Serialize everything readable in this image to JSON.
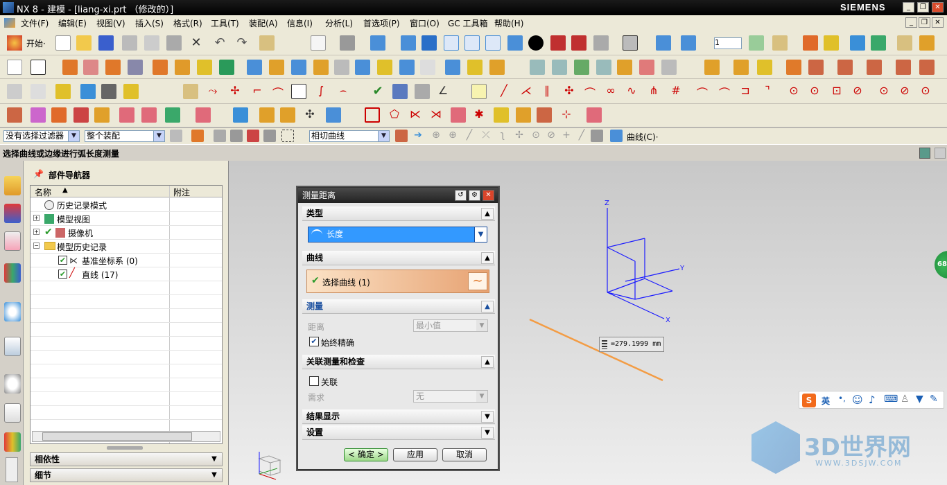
{
  "window": {
    "title": "NX 8 - 建模 - [liang-xi.prt （修改的）]",
    "brand": "SIEMENS",
    "buttons": [
      "_",
      "❐",
      "✕"
    ]
  },
  "menubar": {
    "items": [
      "文件(F)",
      "编辑(E)",
      "视图(V)",
      "插入(S)",
      "格式(R)",
      "工具(T)",
      "装配(A)",
      "信息(I)",
      "分析(L)",
      "首选项(P)",
      "窗口(O)",
      "GC 工具箱",
      "帮助(H)"
    ]
  },
  "toolbar": {
    "start_label": "开始·"
  },
  "filterbar": {
    "filter": "没有选择过滤器",
    "scope": "整个装配",
    "curve_rule": "相切曲线",
    "curve_menu": "曲线(C)·"
  },
  "status": {
    "prompt": "选择曲线或边缘进行弧长度测量"
  },
  "navigator": {
    "title": "部件导航器",
    "columns": [
      "名称",
      "附注"
    ],
    "rows": [
      "历史记录模式",
      "模型视图",
      "摄像机",
      "模型历史记录",
      "基准坐标系 (0)",
      "直线 (17)"
    ],
    "sections": [
      "相依性",
      "细节"
    ]
  },
  "dialog": {
    "title": "测量距离",
    "type_section": "类型",
    "type_value": "长度",
    "curve_section": "曲线",
    "select_curve": "选择曲线 (1)",
    "measure_section": "测量",
    "distance_label": "距离",
    "distance_value": "最小值",
    "always_accurate": "始终精确",
    "assoc_section": "关联测量和检查",
    "assoc_label": "关联",
    "req_label": "需求",
    "req_value": "无",
    "result_section": "结果显示",
    "settings_section": "设置",
    "ok": "< 确定 >",
    "apply": "应用",
    "cancel": "取消"
  },
  "viewport": {
    "measurement": "=279.1999 mm",
    "axes": {
      "x": "X",
      "y": "Y",
      "z": "Z"
    }
  },
  "ime": {
    "lang": "英"
  },
  "watermark": {
    "title": "3D世界网",
    "url": "WWW.3DSJW.COM"
  },
  "colors": {
    "accent": "#3399ff",
    "curve": "#f39c44",
    "wire": "#1a1aff"
  }
}
